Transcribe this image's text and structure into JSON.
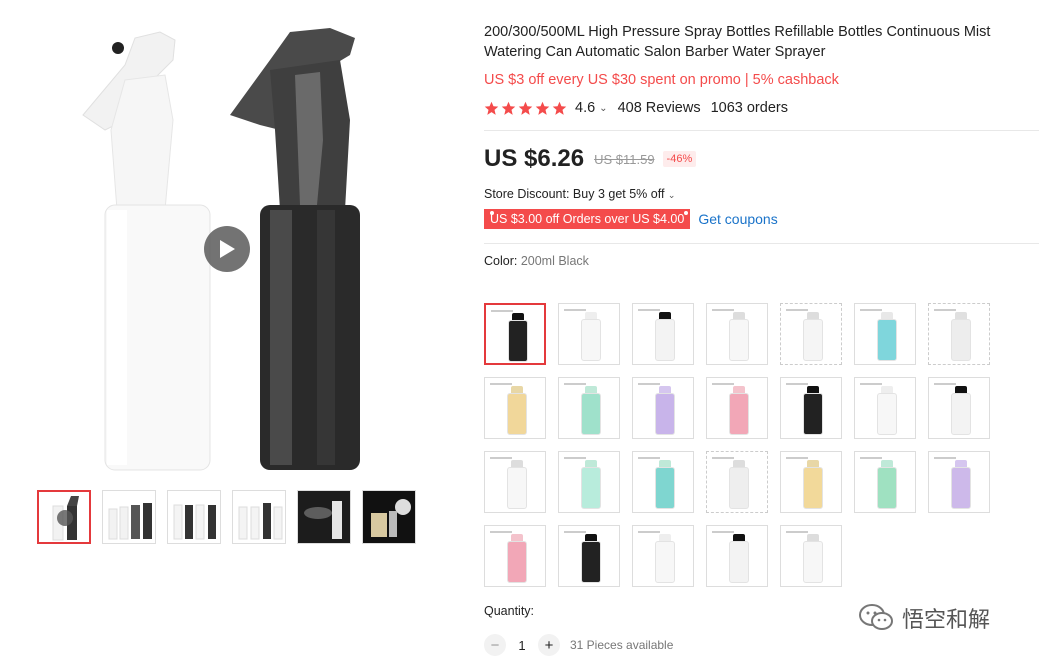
{
  "product": {
    "title": "200/300/500ML High Pressure Spray Bottles Refillable Bottles Continuous Mist Watering Can Automatic Salon Barber Water Sprayer",
    "promo": "US $3 off every US $30 spent on promo | 5% cashback",
    "rating_score": "4.6",
    "reviews": "408 Reviews",
    "orders": "1063 orders",
    "price": "US $6.26",
    "original_price": "US $11.59",
    "discount": "-46%",
    "store_discount": "Store Discount: Buy 3 get 5% off",
    "coupon": "US $3.00 off Orders over US $4.00",
    "get_coupons": "Get coupons",
    "color_label": "Color:",
    "color_value": "200ml Black",
    "quantity_label": "Quantity:",
    "quantity": "1",
    "available": "31 Pieces available",
    "star_color": "#f44b4b",
    "accent": "#e4393c",
    "rating_stars": 5
  },
  "watermark": {
    "text": "悟空和解"
  },
  "gallery": {
    "thumbnails": [
      "thumb-video",
      "thumb-2",
      "thumb-3",
      "thumb-4",
      "thumb-5",
      "thumb-6"
    ]
  },
  "swatches": [
    {
      "color": "#222222",
      "cap": "#111111",
      "style": "solid",
      "selected": true
    },
    {
      "color": "#f7f7f7",
      "cap": "#eeeeee",
      "style": "solid"
    },
    {
      "color": "#f3f3f3",
      "cap": "#111111",
      "style": "solid"
    },
    {
      "color": "#f7f7f7",
      "cap": "#dddddd",
      "style": "solid"
    },
    {
      "color": "#f5f5f5",
      "cap": "#dddddd",
      "style": "dashed"
    },
    {
      "color": "#7fd6dc",
      "cap": "#e8e8e8",
      "style": "solid"
    },
    {
      "color": "#ededed",
      "cap": "#e0e0e0",
      "style": "dashed"
    },
    {
      "color": "#f1d79a",
      "cap": "#e8d7a6",
      "style": "solid"
    },
    {
      "color": "#9fe1cb",
      "cap": "#bfe9d8",
      "style": "solid"
    },
    {
      "color": "#c8b4ea",
      "cap": "#d5c6ef",
      "style": "solid"
    },
    {
      "color": "#f2a7b7",
      "cap": "#f4c3cc",
      "style": "solid"
    },
    {
      "color": "#222222",
      "cap": "#111111",
      "style": "solid"
    },
    {
      "color": "#f7f7f7",
      "cap": "#eeeeee",
      "style": "solid"
    },
    {
      "color": "#f3f3f3",
      "cap": "#111111",
      "style": "solid"
    },
    {
      "color": "#f7f7f7",
      "cap": "#dddddd",
      "style": "solid"
    },
    {
      "color": "#b8ecdc",
      "cap": "#bfe9d8",
      "style": "solid"
    },
    {
      "color": "#7fd6d0",
      "cap": "#bfe9d8",
      "style": "solid"
    },
    {
      "color": "#eeeeee",
      "cap": "#dddddd",
      "style": "dashed"
    },
    {
      "color": "#f2d99a",
      "cap": "#e8d7a6",
      "style": "solid"
    },
    {
      "color": "#9fe1c1",
      "cap": "#bfe9d8",
      "style": "solid"
    },
    {
      "color": "#cdb9ea",
      "cap": "#d5c6ef",
      "style": "solid"
    },
    {
      "color": "#f2a7b7",
      "cap": "#f4c3cc",
      "style": "solid"
    },
    {
      "color": "#222222",
      "cap": "#111111",
      "style": "solid"
    },
    {
      "color": "#f7f7f7",
      "cap": "#eeeeee",
      "style": "solid"
    },
    {
      "color": "#f3f3f3",
      "cap": "#111111",
      "style": "solid"
    },
    {
      "color": "#f7f7f7",
      "cap": "#dddddd",
      "style": "solid"
    }
  ]
}
